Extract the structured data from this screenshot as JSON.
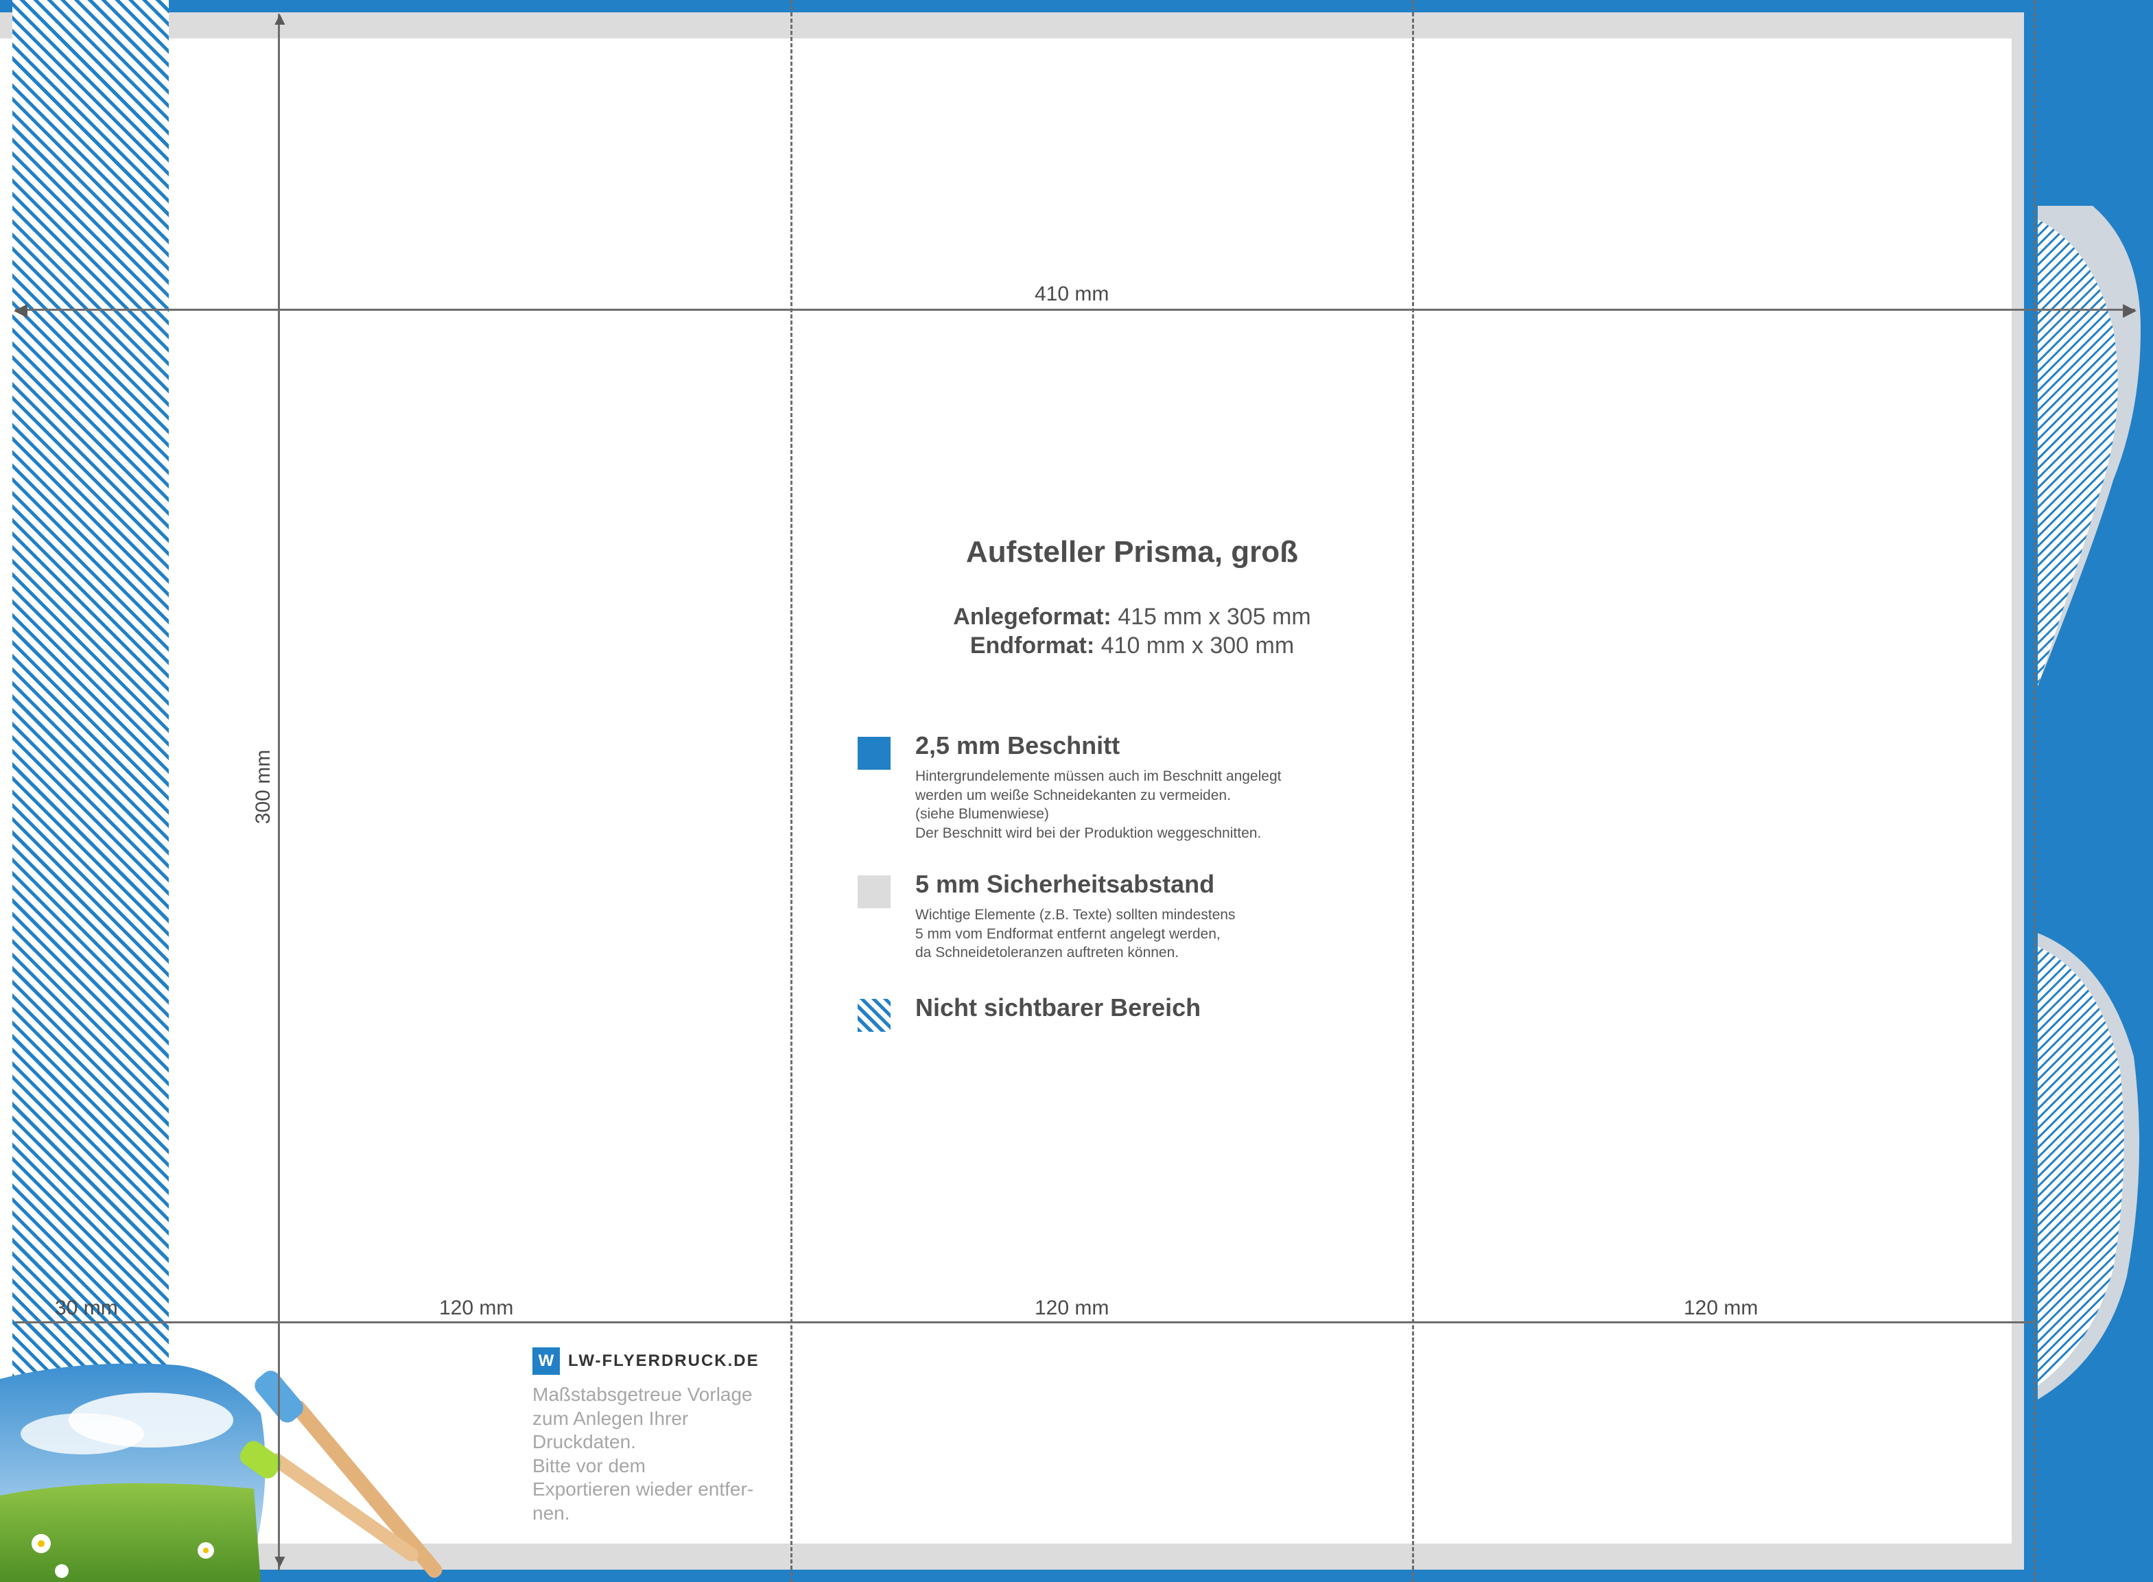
{
  "colors": {
    "bleed": "#2280c6",
    "safety": "#dcdcdc",
    "trim": "#ffffff",
    "text": "#4d4d4d"
  },
  "dimensions": {
    "total_width": "410 mm",
    "height": "300 mm",
    "left_panel": "30 mm",
    "panel_1": "120 mm",
    "panel_2": "120 mm",
    "panel_3": "120 mm"
  },
  "info": {
    "title": "Aufsteller Prisma, groß",
    "anlege_label": "Anlegeformat:",
    "anlege_value": "415 mm x 305 mm",
    "end_label": "Endformat:",
    "end_value": "410 mm x 300 mm"
  },
  "legend": {
    "beschnitt": {
      "icon": "blue-square-icon",
      "title": "2,5 mm Beschnitt",
      "text": "Hintergrundelemente müssen auch im Beschnitt angelegt\nwerden um weiße Schneidekanten zu vermeiden.\n(siehe Blumenwiese)\nDer Beschnitt wird bei der Produktion weggeschnitten."
    },
    "sicherheit": {
      "icon": "grey-square-icon",
      "title": "5 mm Sicherheitsabstand",
      "text": "Wichtige Elemente (z.B. Texte) sollten mindestens\n5 mm vom Endformat entfernt angelegt werden,\nda Schneidetoleranzen auftreten können."
    },
    "nicht_sichtbar": {
      "icon": "hatched-square-icon",
      "title": "Nicht sichtbarer Bereich"
    }
  },
  "brand": {
    "logo": "lw",
    "name": "LW-FLYERDRUCK.DE",
    "note": "Maßstabsgetreue Vorlage\nzum Anlegen Ihrer\nDruckdaten.\nBitte vor dem\nExportieren wieder entfer-\nnen."
  }
}
